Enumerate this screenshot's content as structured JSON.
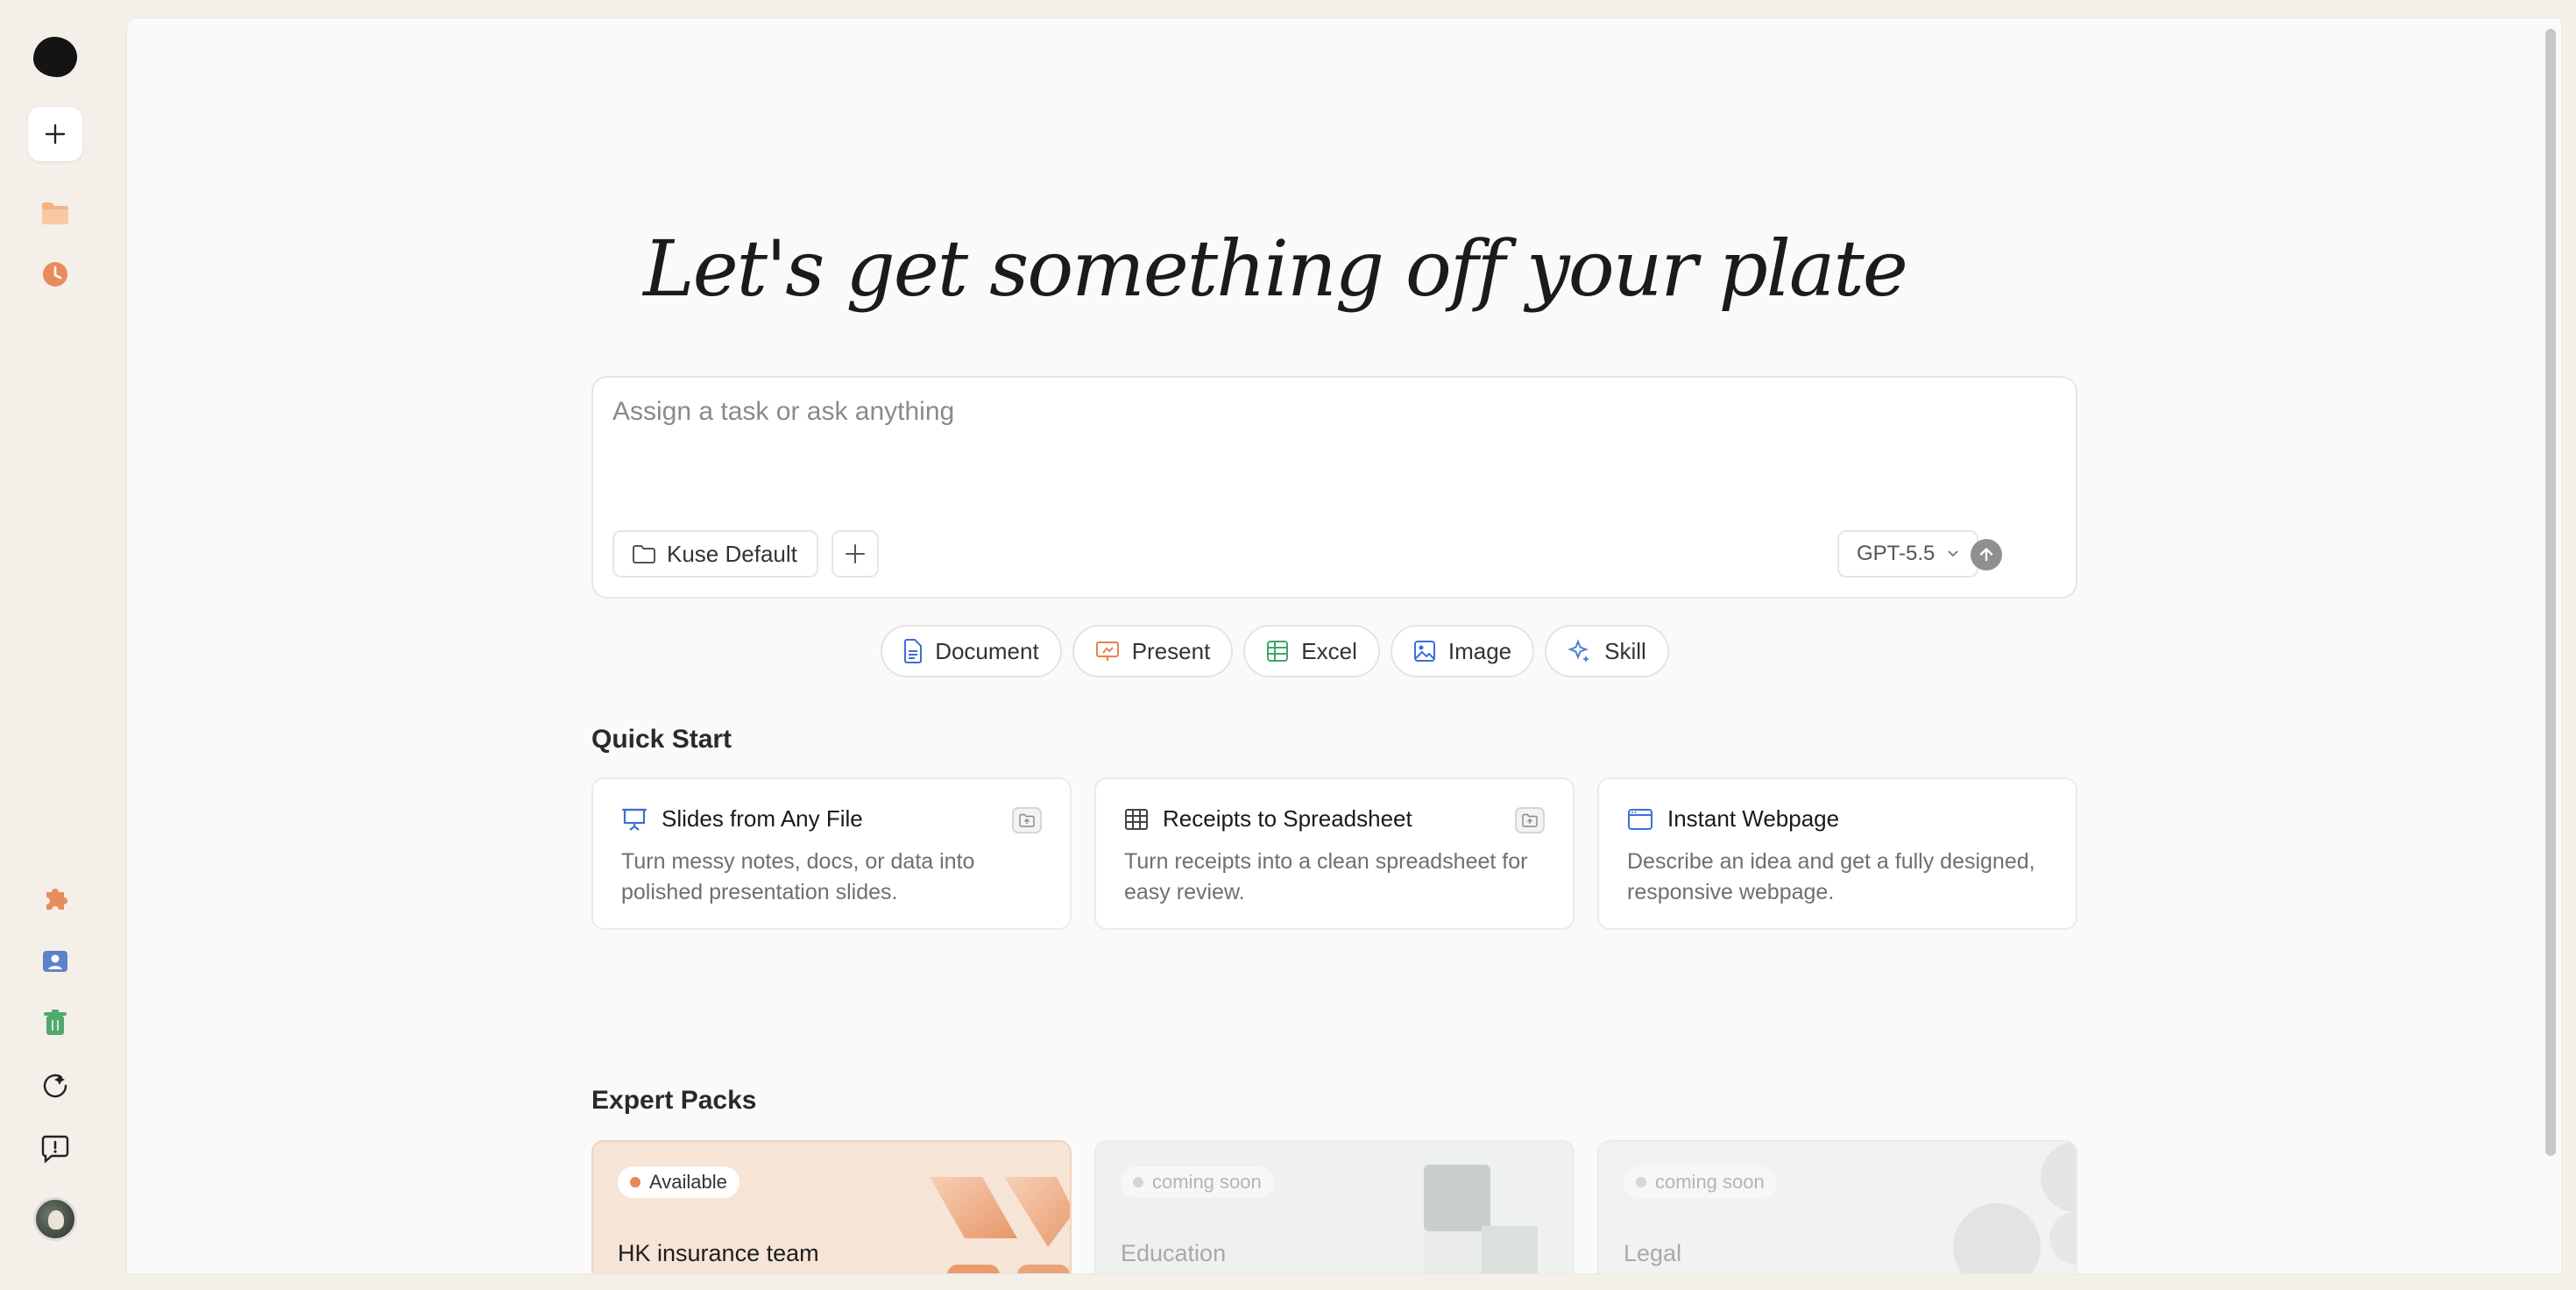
{
  "hero": {
    "title": "Let's get something off your plate"
  },
  "composer": {
    "placeholder": "Assign a task or ask anything",
    "workspace_label": "Kuse Default",
    "model_label": "GPT-5.5"
  },
  "chips": [
    {
      "label": "Document",
      "icon": "document-icon",
      "color": "#3b6fd6"
    },
    {
      "label": "Present",
      "icon": "presentation-icon",
      "color": "#e5834f"
    },
    {
      "label": "Excel",
      "icon": "spreadsheet-icon",
      "color": "#3fa66a"
    },
    {
      "label": "Image",
      "icon": "image-icon",
      "color": "#3b6fd6"
    },
    {
      "label": "Skill",
      "icon": "sparkle-icon",
      "color": "#4a7fd6"
    }
  ],
  "quick_start": {
    "title": "Quick Start",
    "cards": [
      {
        "title": "Slides from Any File",
        "desc": "Turn messy notes, docs, or data into polished presentation slides.",
        "icon": "presentation-board-icon"
      },
      {
        "title": "Receipts to Spreadsheet",
        "desc": "Turn receipts into a clean spreadsheet for easy review.",
        "icon": "table-icon"
      },
      {
        "title": "Instant Webpage",
        "desc": "Describe an idea and get a fully designed, responsive webpage.",
        "icon": "browser-window-icon"
      }
    ]
  },
  "expert_packs": {
    "title": "Expert Packs",
    "cards": [
      {
        "status": "Available",
        "name": "HK insurance team"
      },
      {
        "status": "coming soon",
        "name": "Education"
      },
      {
        "status": "coming soon",
        "name": "Legal"
      }
    ]
  },
  "colors": {
    "accent_orange": "#e5834f",
    "accent_blue": "#3b6fd6",
    "accent_green": "#3fa66a"
  }
}
